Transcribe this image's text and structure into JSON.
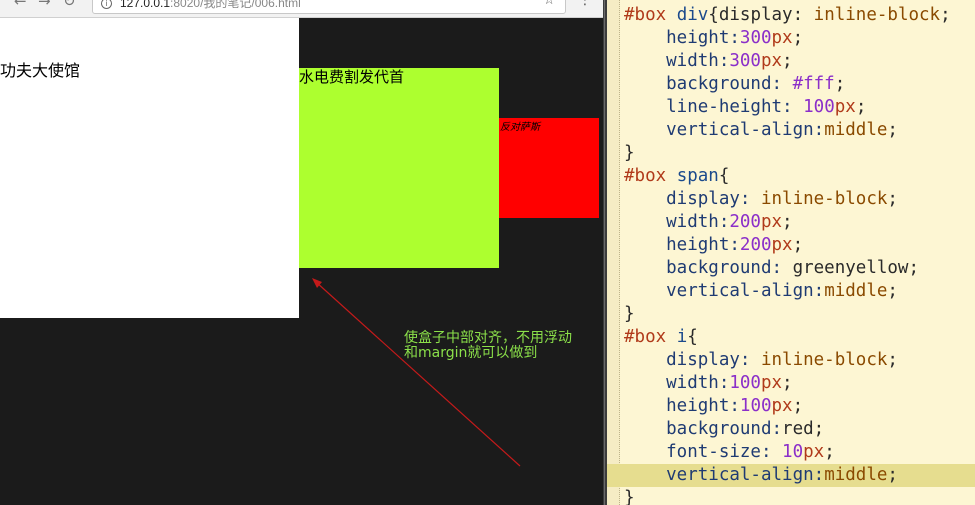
{
  "browser": {
    "url_host": "127.0.0.1",
    "url_rest": ":8020/我的笔记/006.html",
    "demo": {
      "div_text": "功夫大使馆",
      "span_text": "水电费割发代首",
      "i_text": "反对萨斯"
    },
    "annotation": {
      "line1": "使盒子中部对齐，不用浮动",
      "line2": "和margin就可以做到"
    }
  },
  "editor": {
    "lines": [
      [
        {
          "t": "#box ",
          "c": "sel"
        },
        {
          "t": "div",
          "c": "tag"
        },
        {
          "t": "{display: ",
          "c": "punc"
        },
        {
          "t": "inline-block",
          "c": "kw"
        },
        {
          "t": ";",
          "c": "punc"
        }
      ],
      [
        {
          "t": "    height:",
          "c": "prop"
        },
        {
          "t": "300",
          "c": "num"
        },
        {
          "t": "px",
          "c": "unit"
        },
        {
          "t": ";",
          "c": "punc"
        }
      ],
      [
        {
          "t": "    width:",
          "c": "prop"
        },
        {
          "t": "300",
          "c": "num"
        },
        {
          "t": "px",
          "c": "unit"
        },
        {
          "t": ";",
          "c": "punc"
        }
      ],
      [
        {
          "t": "    background: ",
          "c": "prop"
        },
        {
          "t": "#fff",
          "c": "hex"
        },
        {
          "t": ";",
          "c": "punc"
        }
      ],
      [
        {
          "t": "    line-height: ",
          "c": "prop"
        },
        {
          "t": "100",
          "c": "num"
        },
        {
          "t": "px",
          "c": "unit"
        },
        {
          "t": ";",
          "c": "punc"
        }
      ],
      [
        {
          "t": "    vertical-align:",
          "c": "prop"
        },
        {
          "t": "middle",
          "c": "kw"
        },
        {
          "t": ";",
          "c": "punc"
        }
      ],
      [
        {
          "t": "}",
          "c": "punc"
        }
      ],
      [
        {
          "t": "#box ",
          "c": "sel"
        },
        {
          "t": "span",
          "c": "tag"
        },
        {
          "t": "{",
          "c": "punc"
        }
      ],
      [
        {
          "t": "    display: ",
          "c": "prop"
        },
        {
          "t": "inline-block",
          "c": "kw"
        },
        {
          "t": ";",
          "c": "punc"
        }
      ],
      [
        {
          "t": "    width:",
          "c": "prop"
        },
        {
          "t": "200",
          "c": "num"
        },
        {
          "t": "px",
          "c": "unit"
        },
        {
          "t": ";",
          "c": "punc"
        }
      ],
      [
        {
          "t": "    height:",
          "c": "prop"
        },
        {
          "t": "200",
          "c": "num"
        },
        {
          "t": "px",
          "c": "unit"
        },
        {
          "t": ";",
          "c": "punc"
        }
      ],
      [
        {
          "t": "    background: ",
          "c": "prop"
        },
        {
          "t": "greenyellow",
          "c": "punc"
        },
        {
          "t": ";",
          "c": "punc"
        }
      ],
      [
        {
          "t": "    vertical-align:",
          "c": "prop"
        },
        {
          "t": "middle",
          "c": "kw"
        },
        {
          "t": ";",
          "c": "punc"
        }
      ],
      [
        {
          "t": "}",
          "c": "punc"
        }
      ],
      [
        {
          "t": "#box ",
          "c": "sel"
        },
        {
          "t": "i",
          "c": "tag"
        },
        {
          "t": "{",
          "c": "punc"
        }
      ],
      [
        {
          "t": "    display: ",
          "c": "prop"
        },
        {
          "t": "inline-block",
          "c": "kw"
        },
        {
          "t": ";",
          "c": "punc"
        }
      ],
      [
        {
          "t": "    width:",
          "c": "prop"
        },
        {
          "t": "100",
          "c": "num"
        },
        {
          "t": "px",
          "c": "unit"
        },
        {
          "t": ";",
          "c": "punc"
        }
      ],
      [
        {
          "t": "    height:",
          "c": "prop"
        },
        {
          "t": "100",
          "c": "num"
        },
        {
          "t": "px",
          "c": "unit"
        },
        {
          "t": ";",
          "c": "punc"
        }
      ],
      [
        {
          "t": "    background:",
          "c": "prop"
        },
        {
          "t": "red",
          "c": "punc"
        },
        {
          "t": ";",
          "c": "punc"
        }
      ],
      [
        {
          "t": "    font-size: ",
          "c": "prop"
        },
        {
          "t": "10",
          "c": "num"
        },
        {
          "t": "px",
          "c": "unit"
        },
        {
          "t": ";",
          "c": "punc"
        }
      ],
      [
        {
          "t": "    vertical-align:",
          "c": "prop"
        },
        {
          "t": "middle",
          "c": "kw"
        },
        {
          "t": ";",
          "c": "punc"
        }
      ],
      [
        {
          "t": "}",
          "c": "punc"
        }
      ]
    ],
    "highlighted_line": 20
  }
}
